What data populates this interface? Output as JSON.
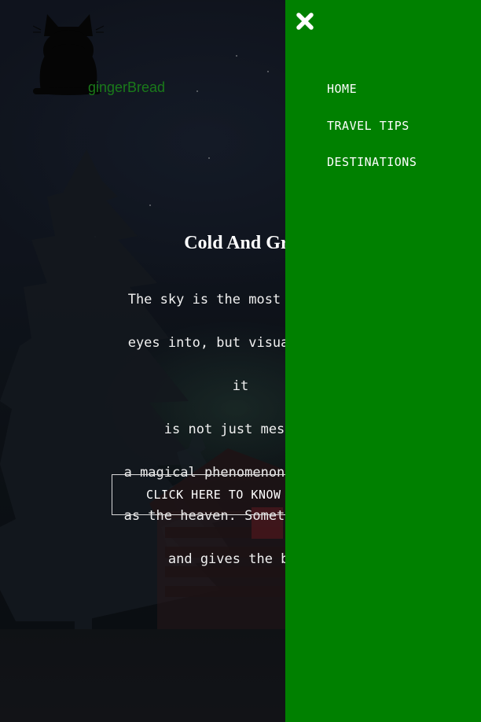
{
  "brand": {
    "name": "gingerBread",
    "logo_icon": "black-cat-icon",
    "text_color": "#1a7a1a"
  },
  "hero": {
    "title": "Cold And Gre",
    "body_lines": [
      "The sky is the most beautifu",
      "eyes into, but visualizing a",
      "it",
      "is not just mesmeri",
      "a magical phenomenon that can",
      "as the heaven. Sometimes, the",
      "and gives the best"
    ],
    "cta_label": "CLICK HERE TO KNOW"
  },
  "sidenav": {
    "background": "#008000",
    "close_icon": "close-x-icon",
    "items": [
      {
        "label": "HOME"
      },
      {
        "label": "TRAVEL TIPS"
      },
      {
        "label": "DESTINATIONS"
      }
    ]
  }
}
